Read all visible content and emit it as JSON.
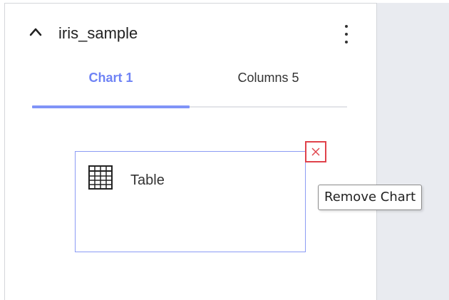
{
  "dataset": {
    "name": "iris_sample",
    "collapse_icon": "chevron-up-icon",
    "more_icon": "more-vertical-icon"
  },
  "tabs": [
    {
      "label": "Chart 1",
      "active": true
    },
    {
      "label": "Columns 5",
      "active": false
    }
  ],
  "chart_card": {
    "icon": "table-icon",
    "label": "Table",
    "remove_icon": "close-icon",
    "remove_tooltip": "Remove Chart"
  },
  "colors": {
    "accent": "#6f83f5",
    "card_border": "#8b9bf4",
    "remove_border": "#e0424b",
    "side_background": "#e9ebf0"
  }
}
